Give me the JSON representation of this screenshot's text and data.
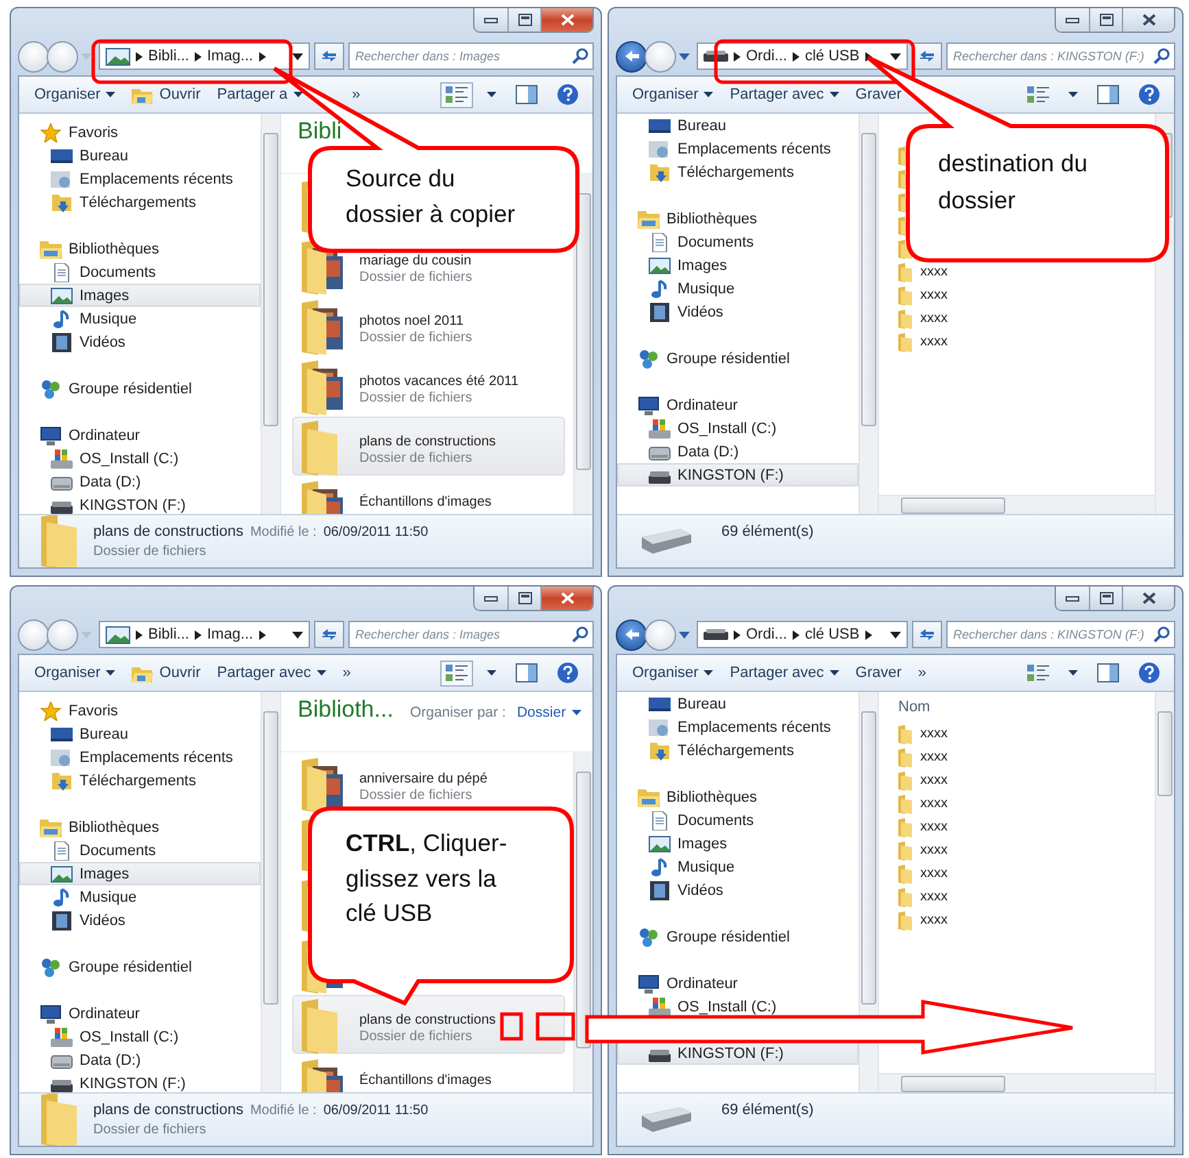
{
  "windows": [
    {
      "kind": "library",
      "active": true,
      "back_enabled": false,
      "address": [
        "Bibli...",
        "Imag..."
      ],
      "search": {
        "placeholder": "Rechercher dans : Images"
      },
      "toolbar": [
        {
          "kind": "menu",
          "label": "Organiser"
        },
        {
          "kind": "open",
          "label": "Ouvrir"
        },
        {
          "kind": "menu",
          "label": "Partager a"
        },
        {
          "kind": "more",
          "label": "»"
        }
      ],
      "nav": [
        {
          "label": "Favoris",
          "kind": "star",
          "selected": false,
          "children": [
            {
              "label": "Bureau",
              "kind": "desktop",
              "selected": false
            },
            {
              "label": "Emplacements récents",
              "kind": "recent",
              "selected": false
            },
            {
              "label": "Téléchargements",
              "kind": "downloads",
              "selected": false
            }
          ]
        },
        {
          "label": "Bibliothèques",
          "kind": "library",
          "selected": false,
          "children": [
            {
              "label": "Documents",
              "kind": "document",
              "selected": false
            },
            {
              "label": "Images",
              "kind": "images",
              "selected": true
            },
            {
              "label": "Musique",
              "kind": "music",
              "selected": false
            },
            {
              "label": "Vidéos",
              "kind": "video",
              "selected": false
            }
          ]
        },
        {
          "label": "Groupe résidentiel",
          "kind": "homegroup",
          "selected": false
        },
        {
          "label": "Ordinateur",
          "kind": "computer",
          "selected": false,
          "children": [
            {
              "label": "OS_Install (C:)",
              "kind": "osdrive",
              "selected": false
            },
            {
              "label": "Data (D:)",
              "kind": "drive",
              "selected": false
            },
            {
              "label": "KINGSTON (F:)",
              "kind": "usb",
              "selected": false
            }
          ]
        }
      ],
      "content": {
        "kind": "tiles",
        "title": "Bibli",
        "items": [
          {
            "kind": "photos",
            "selected": false
          },
          {
            "kind": "photos",
            "name": "mariage du cousin",
            "type": "Dossier de fichiers",
            "selected": false
          },
          {
            "kind": "photos",
            "name": "photos noel 2011",
            "type": "Dossier de fichiers",
            "selected": false
          },
          {
            "kind": "photos",
            "name": "photos vacances été 2011",
            "type": "Dossier de fichiers",
            "selected": false
          },
          {
            "kind": "plain",
            "name": "plans de constructions",
            "type": "Dossier de fichiers",
            "selected": true
          },
          {
            "kind": "photos",
            "name": "Échantillons d'images",
            "selected": false
          }
        ]
      },
      "details": {
        "kind": "item",
        "name": "plans de constructions",
        "modified_label": "Modifié le :",
        "modified_value": "06/09/2011 11:50",
        "type": "Dossier de fichiers"
      }
    },
    {
      "kind": "drive",
      "active": false,
      "back_enabled": true,
      "address": [
        "Ordi...",
        "clé USB"
      ],
      "search": {
        "placeholder": "Rechercher dans : KINGSTON (F:)"
      },
      "toolbar": [
        {
          "kind": "menu",
          "label": "Organiser"
        },
        {
          "kind": "menu",
          "label": "Partager avec"
        },
        {
          "kind": "plain",
          "label": "Graver"
        }
      ],
      "nav": [
        {
          "children": [
            {
              "label": "Bureau",
              "kind": "desktop",
              "selected": false
            },
            {
              "label": "Emplacements récents",
              "kind": "recent",
              "selected": false
            },
            {
              "label": "Téléchargements",
              "kind": "downloads",
              "selected": false
            }
          ]
        },
        {
          "label": "Bibliothèques",
          "kind": "library",
          "selected": false,
          "children": [
            {
              "label": "Documents",
              "kind": "document",
              "selected": false
            },
            {
              "label": "Images",
              "kind": "images",
              "selected": false
            },
            {
              "label": "Musique",
              "kind": "music",
              "selected": false
            },
            {
              "label": "Vidéos",
              "kind": "video",
              "selected": false
            }
          ]
        },
        {
          "label": "Groupe résidentiel",
          "kind": "homegroup",
          "selected": false
        },
        {
          "label": "Ordinateur",
          "kind": "computer",
          "selected": false,
          "children": [
            {
              "label": "OS_Install (C:)",
              "kind": "osdrive",
              "selected": false
            },
            {
              "label": "Data (D:)",
              "kind": "drive",
              "selected": false
            },
            {
              "label": "KINGSTON (F:)",
              "kind": "usb",
              "selected": true
            }
          ]
        }
      ],
      "content": {
        "kind": "list",
        "items": [
          {
            "kind": "folder"
          },
          {
            "kind": "folder"
          },
          {
            "kind": "folder"
          },
          {
            "kind": "folder"
          },
          {
            "kind": "folder"
          },
          {
            "kind": "folder",
            "name": "xxxx"
          },
          {
            "kind": "folder",
            "name": "xxxx"
          },
          {
            "kind": "folder",
            "name": "xxxx"
          },
          {
            "kind": "folder",
            "name": "xxxx"
          }
        ]
      },
      "details": {
        "kind": "count",
        "count": "69 élément(s)"
      }
    },
    {
      "kind": "library",
      "active": true,
      "back_enabled": false,
      "address": [
        "Bibli...",
        "Imag..."
      ],
      "search": {
        "placeholder": "Rechercher dans : Images"
      },
      "toolbar": [
        {
          "kind": "menu",
          "label": "Organiser"
        },
        {
          "kind": "open",
          "label": "Ouvrir"
        },
        {
          "kind": "menu",
          "label": "Partager avec"
        },
        {
          "kind": "plain",
          "label": "»"
        }
      ],
      "nav": [
        {
          "label": "Favoris",
          "kind": "star",
          "selected": false,
          "children": [
            {
              "label": "Bureau",
              "kind": "desktop",
              "selected": false
            },
            {
              "label": "Emplacements récents",
              "kind": "recent",
              "selected": false
            },
            {
              "label": "Téléchargements",
              "kind": "downloads",
              "selected": false
            }
          ]
        },
        {
          "label": "Bibliothèques",
          "kind": "library",
          "selected": false,
          "children": [
            {
              "label": "Documents",
              "kind": "document",
              "selected": false
            },
            {
              "label": "Images",
              "kind": "images",
              "selected": true
            },
            {
              "label": "Musique",
              "kind": "music",
              "selected": false
            },
            {
              "label": "Vidéos",
              "kind": "video",
              "selected": false
            }
          ]
        },
        {
          "label": "Groupe résidentiel",
          "kind": "homegroup",
          "selected": false
        },
        {
          "label": "Ordinateur",
          "kind": "computer",
          "selected": false,
          "children": [
            {
              "label": "OS_Install (C:)",
              "kind": "osdrive",
              "selected": false
            },
            {
              "label": "Data (D:)",
              "kind": "drive",
              "selected": false
            },
            {
              "label": "KINGSTON (F:)",
              "kind": "usb",
              "selected": false
            }
          ]
        }
      ],
      "content": {
        "kind": "tiles",
        "title": "Biblioth...",
        "arrange_label": "Organiser par :",
        "arrange_value": "Dossier",
        "items": [
          {
            "kind": "photos",
            "name": "anniversaire du pépé",
            "type": "Dossier de fichiers",
            "selected": false
          },
          {
            "kind": "photos",
            "selected": false
          },
          {
            "kind": "photos",
            "selected": false
          },
          {
            "kind": "photos",
            "selected": false
          },
          {
            "kind": "plain",
            "name": "plans de constructions",
            "type": "Dossier de fichiers",
            "selected": true
          },
          {
            "kind": "photos",
            "name": "Échantillons d'images",
            "selected": false
          }
        ]
      },
      "details": {
        "kind": "item",
        "name": "plans de constructions",
        "modified_label": "Modifié le :",
        "modified_value": "06/09/2011 11:50",
        "type": "Dossier de fichiers"
      }
    },
    {
      "kind": "drive",
      "active": false,
      "back_enabled": true,
      "address": [
        "Ordi...",
        "clé USB"
      ],
      "search": {
        "placeholder": "Rechercher dans : KINGSTON (F:)"
      },
      "toolbar": [
        {
          "kind": "menu",
          "label": "Organiser"
        },
        {
          "kind": "menu",
          "label": "Partager avec"
        },
        {
          "kind": "plain",
          "label": "Graver"
        },
        {
          "kind": "plain",
          "label": "»"
        }
      ],
      "nav": [
        {
          "children": [
            {
              "label": "Bureau",
              "kind": "desktop",
              "selected": false
            },
            {
              "label": "Emplacements récents",
              "kind": "recent",
              "selected": false
            },
            {
              "label": "Téléchargements",
              "kind": "downloads",
              "selected": false
            }
          ]
        },
        {
          "label": "Bibliothèques",
          "kind": "library",
          "selected": false,
          "children": [
            {
              "label": "Documents",
              "kind": "document",
              "selected": false
            },
            {
              "label": "Images",
              "kind": "images",
              "selected": false
            },
            {
              "label": "Musique",
              "kind": "music",
              "selected": false
            },
            {
              "label": "Vidéos",
              "kind": "video",
              "selected": false
            }
          ]
        },
        {
          "label": "Groupe résidentiel",
          "kind": "homegroup",
          "selected": false
        },
        {
          "label": "Ordinateur",
          "kind": "computer",
          "selected": false,
          "children": [
            {
              "label": "OS_Install (C:)",
              "kind": "osdrive",
              "selected": false
            },
            {
              "kind": "drive"
            },
            {
              "label": "KINGSTON (F:)",
              "kind": "usb",
              "selected": true
            }
          ]
        }
      ],
      "content": {
        "kind": "list",
        "column": "Nom",
        "items": [
          {
            "kind": "folder",
            "name": "xxxx"
          },
          {
            "kind": "folder",
            "name": "xxxx"
          },
          {
            "kind": "folder",
            "name": "xxxx"
          },
          {
            "kind": "folder",
            "name": "xxxx"
          },
          {
            "kind": "folder",
            "name": "xxxx"
          },
          {
            "kind": "folder",
            "name": "xxxx"
          },
          {
            "kind": "folder",
            "name": "xxxx"
          },
          {
            "kind": "folder",
            "name": "xxxx"
          },
          {
            "kind": "folder",
            "name": "xxxx"
          }
        ]
      },
      "details": {
        "kind": "count",
        "count": "69 élément(s)"
      }
    }
  ],
  "callouts": [
    {
      "text": "Source du dossier à copier"
    },
    {
      "text": "destination du dossier"
    },
    {
      "text": "**CTRL**, Cliquer-glissez vers la clé USB"
    }
  ]
}
